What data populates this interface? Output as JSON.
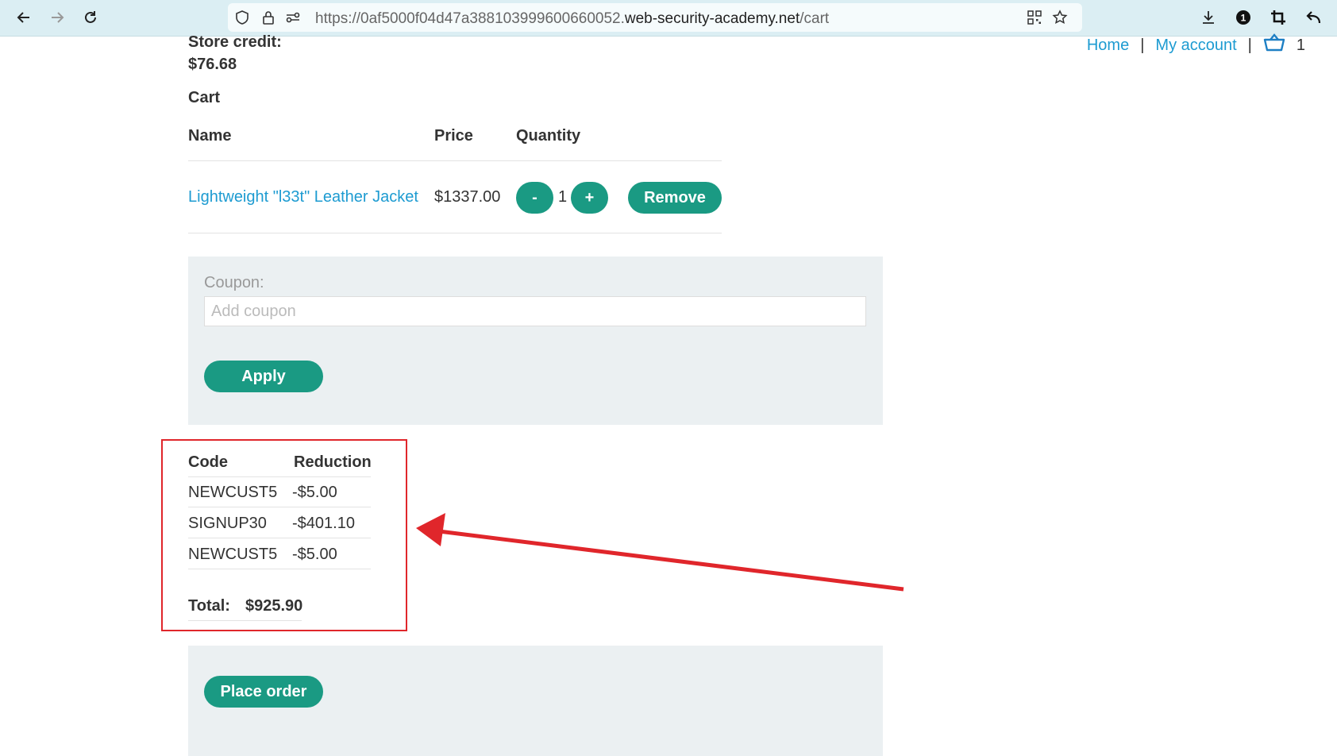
{
  "browser": {
    "url_prefix": "https://0af5000f04d47a388103999600660052.",
    "url_host": "web-security-academy.net",
    "url_path": "/cart",
    "extension_badge": "1"
  },
  "header": {
    "store_credit_label": "Store credit:",
    "store_credit_value": "$76.68",
    "nav": {
      "home": "Home",
      "my_account": "My account",
      "separator": "|",
      "cart_count": "1"
    }
  },
  "cart": {
    "title": "Cart",
    "columns": [
      "Name",
      "Price",
      "Quantity"
    ],
    "items": [
      {
        "name": "Lightweight \"l33t\" Leather Jacket",
        "price": "$1337.00",
        "quantity": "1",
        "decrement_label": "-",
        "increment_label": "+",
        "remove_label": "Remove"
      }
    ]
  },
  "coupon": {
    "label": "Coupon:",
    "placeholder": "Add coupon",
    "value": "",
    "apply_label": "Apply"
  },
  "reductions": {
    "columns": [
      "Code",
      "Reduction"
    ],
    "rows": [
      {
        "code": "NEWCUST5",
        "reduction": "-$5.00"
      },
      {
        "code": "SIGNUP30",
        "reduction": "-$401.10"
      },
      {
        "code": "NEWCUST5",
        "reduction": "-$5.00"
      }
    ],
    "total_label": "Total:",
    "total_value": "$925.90"
  },
  "order": {
    "place_order_label": "Place order"
  },
  "colors": {
    "accent": "#1a9a83",
    "link": "#1d9bd1",
    "annotation": "#e0262b",
    "panel": "#ebf0f2"
  }
}
